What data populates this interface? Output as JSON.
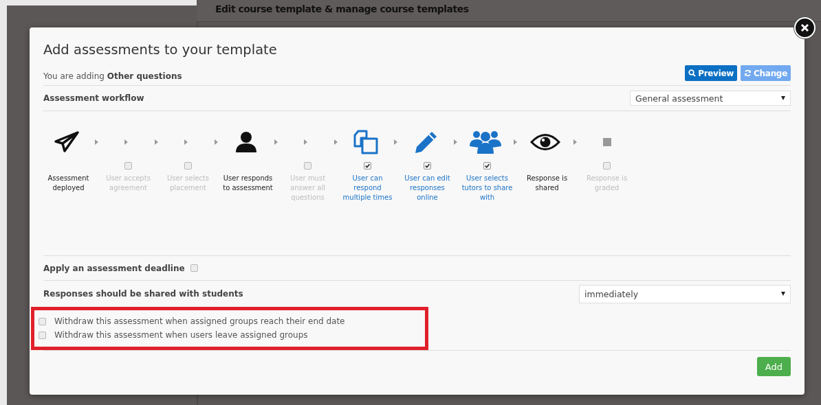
{
  "page": {
    "heading": "Edit course template & manage course templates"
  },
  "modal": {
    "title": "Add assessments to your template",
    "subtitle": "You are adding **Other questions**",
    "buttons": [
      {
        "label": "Preview",
        "kind": "primary"
      },
      {
        "label": "Change",
        "kind": "secondary"
      }
    ],
    "workflow": {
      "label": "Assessment workflow",
      "select": {
        "value": "General assessment"
      },
      "steps": [
        {
          "label": "Assessment deployed",
          "kind": "fixed"
        },
        {
          "label": "User accepts agreement",
          "kind": "optional",
          "checked": false
        },
        {
          "label": "User selects placement",
          "kind": "optional",
          "checked": false
        },
        {
          "label": "User responds to assessment",
          "kind": "fixed"
        },
        {
          "label": "User must answer all questions",
          "kind": "optional",
          "checked": false
        },
        {
          "label": "User can respond multiple times",
          "kind": "optional",
          "checked": true
        },
        {
          "label": "User can edit responses online",
          "kind": "optional",
          "checked": true
        },
        {
          "label": "User selects tutors to share with",
          "kind": "optional",
          "checked": true
        },
        {
          "label": "Response is shared",
          "kind": "fixed"
        },
        {
          "label": "Response is graded",
          "kind": "optional",
          "checked": false
        }
      ]
    },
    "deadline": {
      "label": "Apply an assessment deadline",
      "checked": false
    },
    "sharing": {
      "label": "Responses should be shared with students",
      "select": {
        "value": "immediately"
      }
    },
    "withdraw_options": {
      "highlighted": true,
      "items": [
        {
          "label": "Withdraw this assessment when assigned groups reach their end date",
          "checked": false
        },
        {
          "label": "Withdraw this assessment when users leave assigned groups",
          "checked": false
        }
      ]
    },
    "add_button": "Add"
  }
}
